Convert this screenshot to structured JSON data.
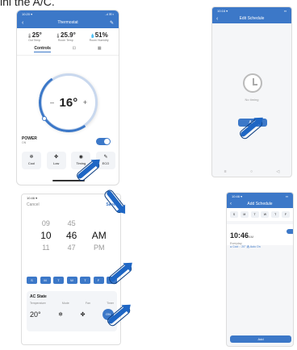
{
  "caption": "ini the A/C.",
  "colors": {
    "accent": "#3c78c8",
    "arrow": "#1e66c4"
  },
  "p1": {
    "status_time": "10:20 ▾",
    "status_right": "..ıl ✉ ▪",
    "title": "Thermostat",
    "stats": [
      {
        "icon": "thermo-icon",
        "value": "25°",
        "label": "Out Temp"
      },
      {
        "icon": "thermo-icon",
        "value": "25.9°",
        "label": "Room Temp"
      },
      {
        "icon": "humidity-icon",
        "value": "51%",
        "label": "Room Humidity"
      }
    ],
    "tabs": [
      "Controls",
      "⊡",
      "▦"
    ],
    "setpoint": "16°",
    "minus": "–",
    "plus": "+",
    "power_label": "POWER",
    "power_state": "ON",
    "modes": [
      {
        "icon": "cool-icon",
        "glyph": "❄",
        "label": "Cool"
      },
      {
        "icon": "fan-icon",
        "glyph": "✤",
        "label": "Low"
      },
      {
        "icon": "timing-icon",
        "glyph": "◉",
        "label": "Timing"
      },
      {
        "icon": "eco-icon",
        "glyph": "✎",
        "label": "ECO"
      }
    ]
  },
  "p2": {
    "title": "Edit Schedule",
    "empty": "No timing",
    "add": "Add"
  },
  "p3": {
    "cancel": "Cancel",
    "save": "Save",
    "hours": [
      "09",
      "10",
      "11"
    ],
    "minutes": [
      "45",
      "46",
      "47"
    ],
    "ampm": [
      "AM",
      "PM"
    ],
    "days": [
      "S",
      "M",
      "T",
      "W",
      "T",
      "F",
      "S"
    ],
    "section": "AC State",
    "cols": [
      "Temperature",
      "Mode",
      "Fan",
      "Timer"
    ],
    "temp": "20°",
    "on": "ON"
  },
  "p4": {
    "title": "Add Schedule",
    "days": [
      "S",
      "M",
      "T",
      "W",
      "T",
      "F"
    ],
    "time": "10:46",
    "ampm": "AM",
    "sub": "Everyday",
    "detail": "● Cool  ◌ 20°  ⁂ Auto  On",
    "add": "Add"
  }
}
